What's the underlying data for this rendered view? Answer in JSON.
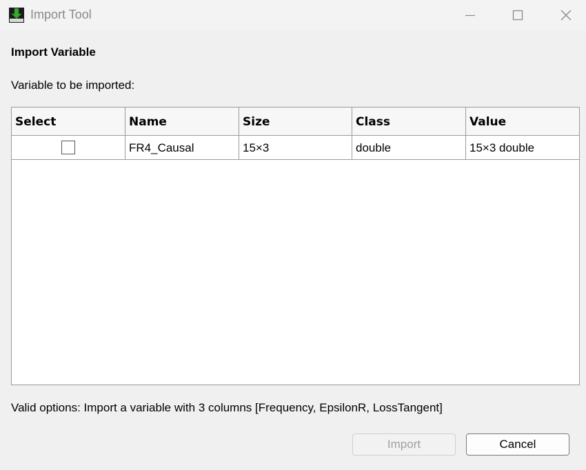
{
  "window": {
    "title": "Import Tool",
    "icon": "import-download-icon"
  },
  "dialog": {
    "section_title": "Import Variable",
    "subtitle": "Variable to be imported:",
    "table": {
      "columns": [
        "Select",
        "Name",
        "Size",
        "Class",
        "Value"
      ],
      "rows": [
        {
          "selected": false,
          "name": "FR4_Causal",
          "size": "15×3",
          "class": "double",
          "value": "15×3 double"
        }
      ]
    },
    "hint": "Valid options: Import a variable with 3 columns [Frequency, EpsilonR, LossTangent]",
    "buttons": {
      "import_label": "Import",
      "import_enabled": false,
      "cancel_label": "Cancel"
    }
  },
  "colors": {
    "background": "#f0f0f0",
    "table_border": "#9a9a9a",
    "disabled_text": "#a0a0a0",
    "icon_green": "#3aa832"
  }
}
